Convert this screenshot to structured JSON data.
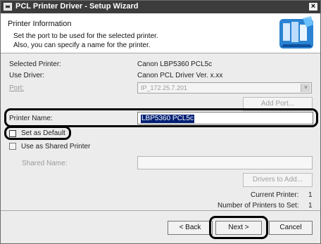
{
  "window": {
    "title": "PCL Printer Driver - Setup Wizard",
    "close_symbol": "×"
  },
  "header": {
    "title": "Printer Information",
    "description_line_1": "Set the port to be used for the selected printer.",
    "description_line_2": "Also, you can specify a name for the printer.",
    "icon": "printer-setup-icon"
  },
  "form": {
    "selected_printer_label": "Selected Printer:",
    "selected_printer_value": "Canon LBP5360 PCL5c",
    "use_driver_label": "Use Driver:",
    "use_driver_value": "Canon PCL Driver Ver. x.xx",
    "port_label": "Port:",
    "port_value": "IP_172.25.7.201",
    "add_port_button": "Add Port...",
    "printer_name_label": "Printer Name:",
    "printer_name_value": "LBP5360 PCL5c",
    "set_default_label": "Set as Default",
    "shared_printer_label": "Use as Shared Printer",
    "shared_name_label": "Shared Name:",
    "drivers_button": "Drivers to Add...",
    "current_printer_label": "Current Printer:",
    "current_printer_value": "1",
    "printers_to_set_label": "Number of Printers to Set:",
    "printers_to_set_value": "1"
  },
  "footer": {
    "back_button": "< Back",
    "next_button": "Next >",
    "cancel_button": "Cancel"
  },
  "colors": {
    "title_bar": "#3c3c3c",
    "selection": "#001f74",
    "highlight_outline": "#000000"
  }
}
